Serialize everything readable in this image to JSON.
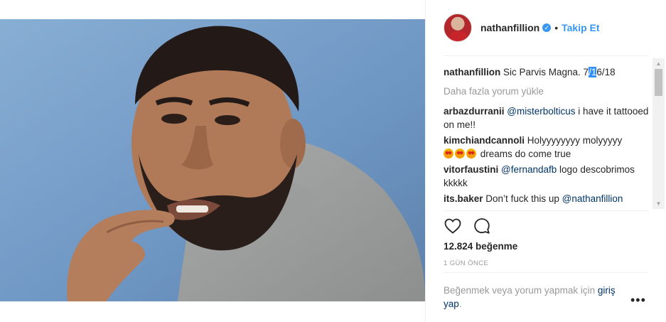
{
  "post": {
    "header": {
      "username": "nathanfillion",
      "separator": "•",
      "follow_label": "Takip Et"
    },
    "caption": {
      "username": "nathanfillion",
      "text_before": "Sic Parvis Magna. 7",
      "text_selected": "/1",
      "text_after": "6/18"
    },
    "load_more_label": "Daha fazla yorum yükle",
    "comments": [
      {
        "username": "arbazdurranii",
        "mention": "@misterbolticus",
        "text": " i have it tattooed on me!!"
      },
      {
        "username": "kimchiandcannoli",
        "text": "Holyyyyyyyy molyyyyy",
        "emoji_text": " dreams do come true"
      },
      {
        "username": "vitorfaustini",
        "mention": "@fernandafb",
        "text": " logo descobrimos kkkkk"
      },
      {
        "username": "its.baker",
        "text": "Don’t fuck this up ",
        "mention": "@nathanfillion"
      }
    ],
    "likes": "12.824 beğenme",
    "time_ago": "1 GÜN ÖNCE",
    "login_prompt": {
      "text": "Beğenmek veya yorum yapmak için ",
      "link": "giriş yap",
      "end": "."
    },
    "more_options": "•••"
  },
  "icons": {
    "like": "heart-outline-icon",
    "comment": "comment-bubble-icon",
    "verified": "verified-badge-icon"
  },
  "colors": {
    "link_blue": "#3897f0",
    "mention_blue": "#003569",
    "muted": "#999999",
    "selection": "#3390ff"
  }
}
